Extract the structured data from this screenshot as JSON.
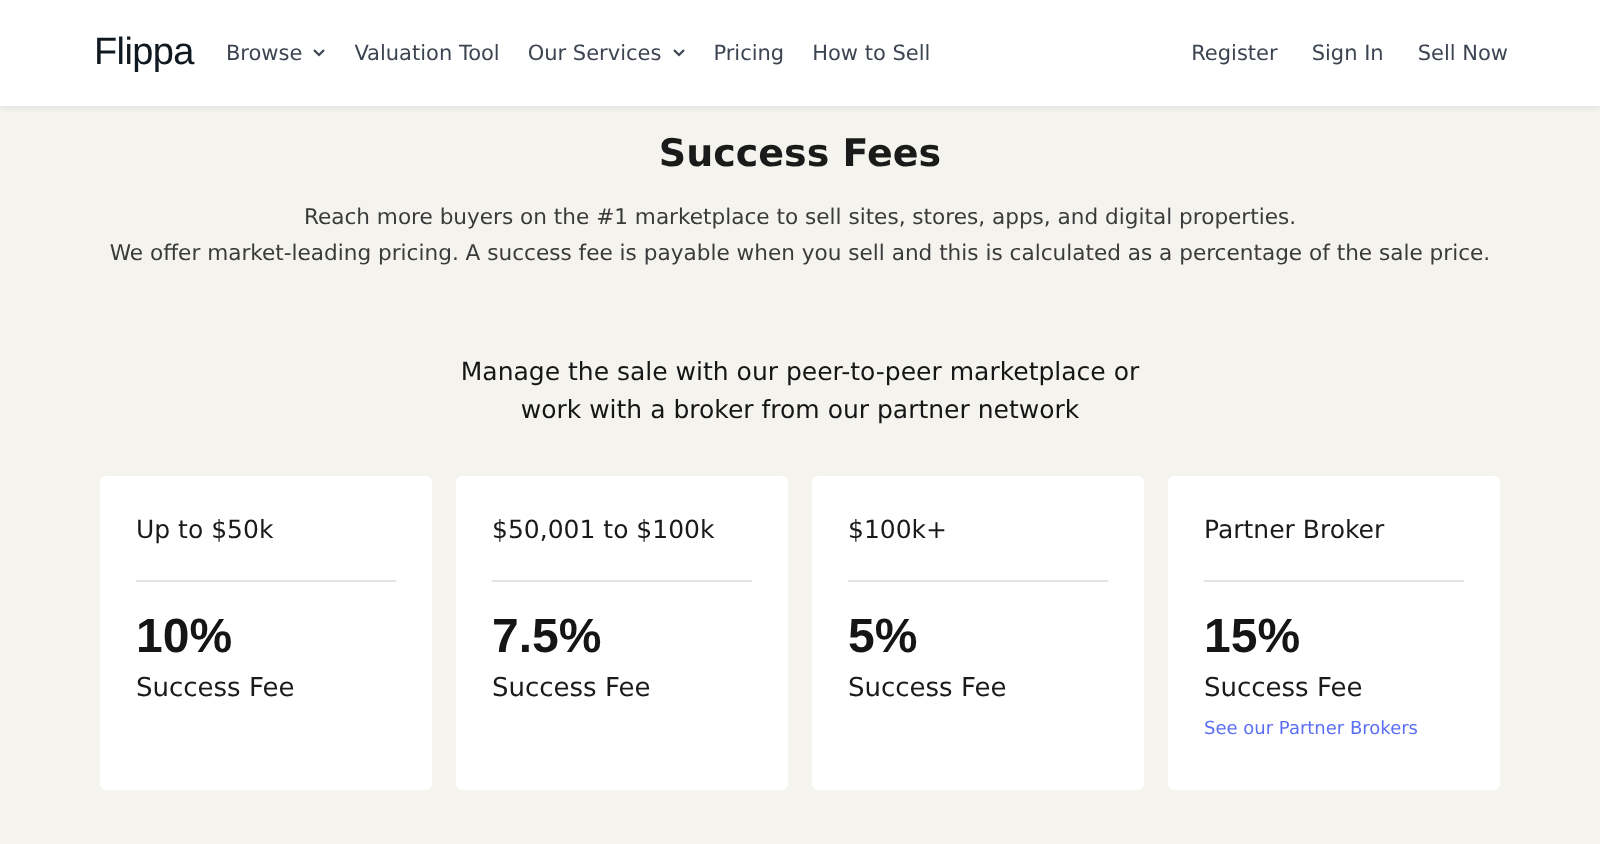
{
  "header": {
    "logo": "Flippa",
    "nav": [
      {
        "label": "Browse",
        "dropdown": true
      },
      {
        "label": "Valuation Tool",
        "dropdown": false
      },
      {
        "label": "Our Services",
        "dropdown": true
      },
      {
        "label": "Pricing",
        "dropdown": false
      },
      {
        "label": "How to Sell",
        "dropdown": false
      }
    ],
    "actions": [
      "Register",
      "Sign In",
      "Sell Now"
    ]
  },
  "title": "Success Fees",
  "intro": [
    "Reach more buyers on the #1 marketplace to sell sites, stores, apps, and digital properties.",
    "We offer market-leading pricing. A success fee is payable when you sell and this is calculated as a percentage of the sale price."
  ],
  "subtitle": [
    "Manage the sale with our peer-to-peer marketplace or",
    "work with a broker from our partner network"
  ],
  "cards": [
    {
      "range": "Up to $50k",
      "rate": "10%",
      "label": "Success Fee"
    },
    {
      "range": "$50,001 to $100k",
      "rate": "7.5%",
      "label": "Success Fee"
    },
    {
      "range": "$100k+",
      "rate": "5%",
      "label": "Success Fee"
    },
    {
      "range": "Partner Broker",
      "rate": "15%",
      "label": "Success Fee",
      "link": "See our Partner Brokers"
    }
  ]
}
